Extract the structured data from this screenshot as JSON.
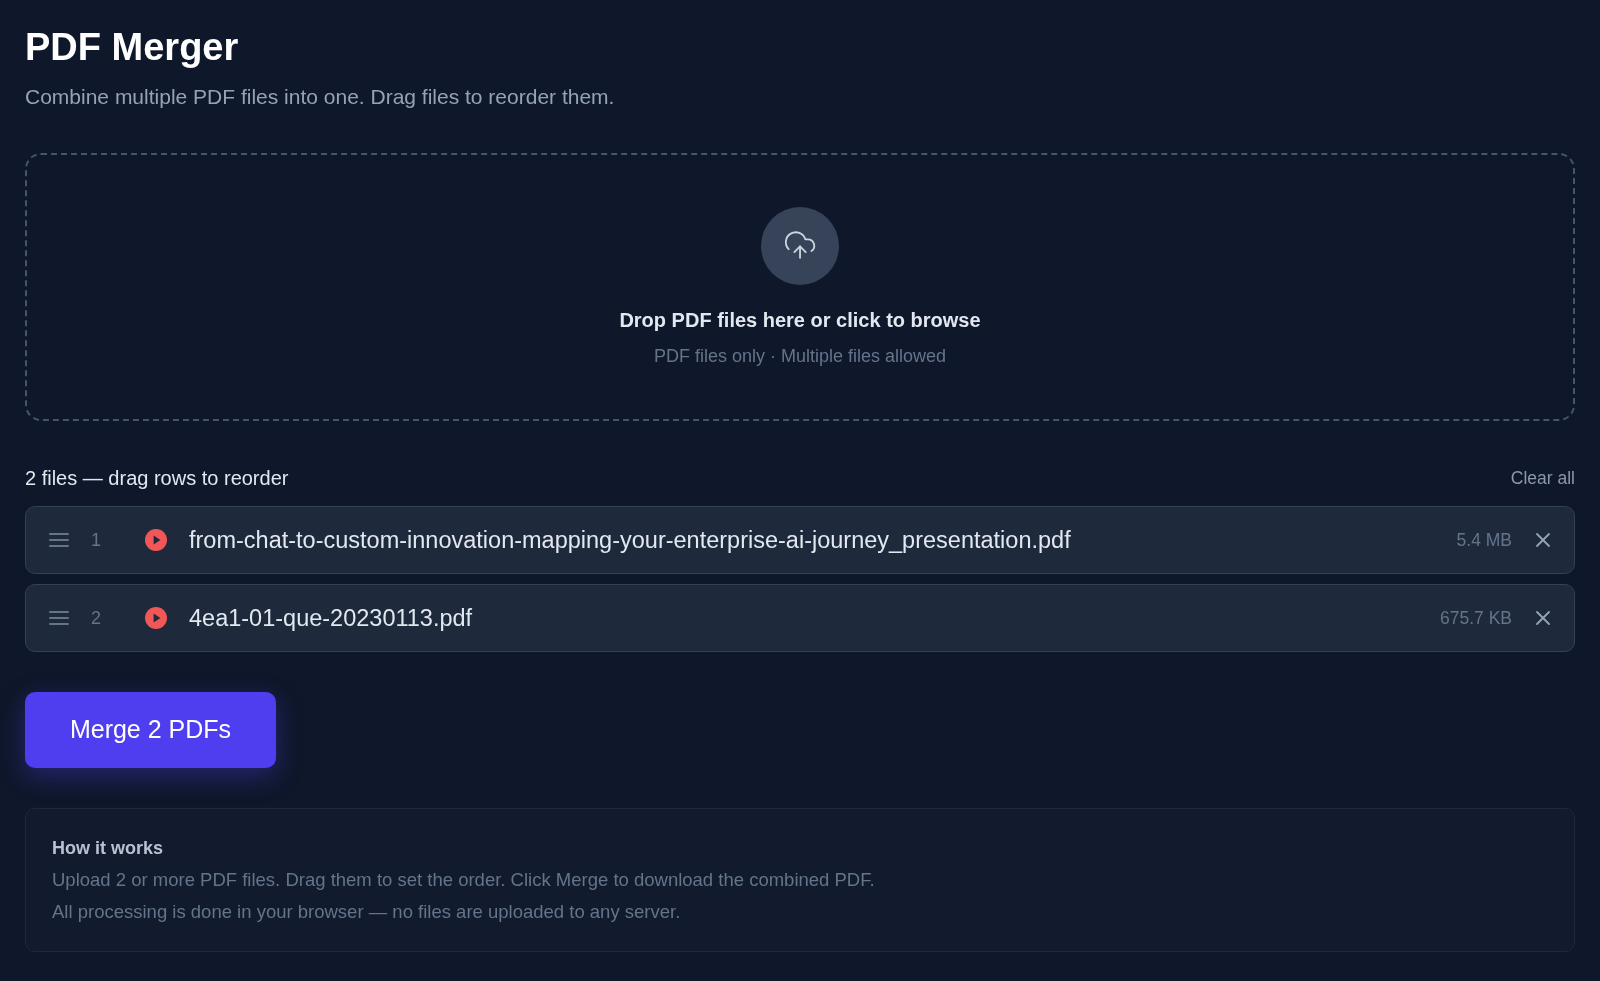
{
  "header": {
    "title": "PDF Merger",
    "subtitle": "Combine multiple PDF files into one. Drag files to reorder them."
  },
  "dropzone": {
    "title": "Drop PDF files here or click to browse",
    "hint": "PDF files only · Multiple files allowed"
  },
  "file_list": {
    "summary": "2 files — drag rows to reorder",
    "clear_label": "Clear all",
    "files": [
      {
        "number": "1",
        "name": "from-chat-to-custom-innovation-mapping-your-enterprise-ai-journey_presentation.pdf",
        "size": "5.4 MB"
      },
      {
        "number": "2",
        "name": "4ea1-01-que-20230113.pdf",
        "size": "675.7 KB"
      }
    ]
  },
  "merge_button": {
    "label": "Merge 2 PDFs"
  },
  "info": {
    "title": "How it works",
    "lines": [
      "Upload 2 or more PDF files. Drag them to set the order. Click Merge to download the combined PDF.",
      "All processing is done in your browser — no files are uploaded to any server."
    ]
  }
}
